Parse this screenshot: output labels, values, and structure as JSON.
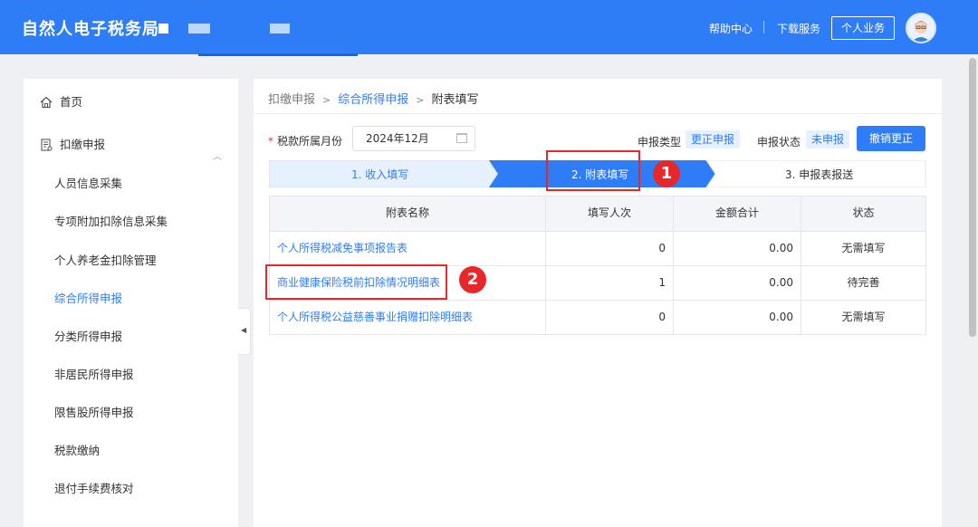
{
  "header": {
    "title": "自然人电子税务局",
    "nav": {
      "help": "帮助中心",
      "download": "下载服务",
      "personal": "个人业务"
    }
  },
  "sidebar": {
    "home": "首页",
    "section": "扣缴申报",
    "items": [
      {
        "label": "人员信息采集"
      },
      {
        "label": "专项附加扣除信息采集"
      },
      {
        "label": "个人养老金扣除管理"
      },
      {
        "label": "综合所得申报",
        "active": true
      },
      {
        "label": "分类所得申报"
      },
      {
        "label": "非居民所得申报"
      },
      {
        "label": "限售股所得申报"
      },
      {
        "label": "税款缴纳"
      },
      {
        "label": "退付手续费核对"
      }
    ]
  },
  "breadcrumb": {
    "level1": "扣缴申报",
    "level2": "综合所得申报",
    "level3": "附表填写"
  },
  "form": {
    "period_label": "税款所属月份",
    "period_value": "2024年12月",
    "report_type_label": "申报类型",
    "report_type_value": "更正申报",
    "report_status_label": "申报状态",
    "report_status_value": "未申报",
    "revoke_button": "撤销更正"
  },
  "steps": [
    {
      "label": "1. 收入填写",
      "state": "done"
    },
    {
      "label": "2. 附表填写",
      "state": "current"
    },
    {
      "label": "3. 申报表报送",
      "state": "pending"
    }
  ],
  "table": {
    "headers": [
      "附表名称",
      "填写人次",
      "金额合计",
      "状态"
    ],
    "rows": [
      {
        "name": "个人所得税减免事项报告表",
        "times": "0",
        "amount": "0.00",
        "status": "无需填写"
      },
      {
        "name": "商业健康保险税前扣除情况明细表",
        "times": "1",
        "amount": "0.00",
        "status": "待完善"
      },
      {
        "name": "个人所得税公益慈善事业捐赠扣除明细表",
        "times": "0",
        "amount": "0.00",
        "status": "无需填写"
      }
    ]
  },
  "annotations": [
    "1",
    "2"
  ],
  "colors": {
    "primary": "#2e7cf6",
    "annotation": "#e8272a"
  }
}
